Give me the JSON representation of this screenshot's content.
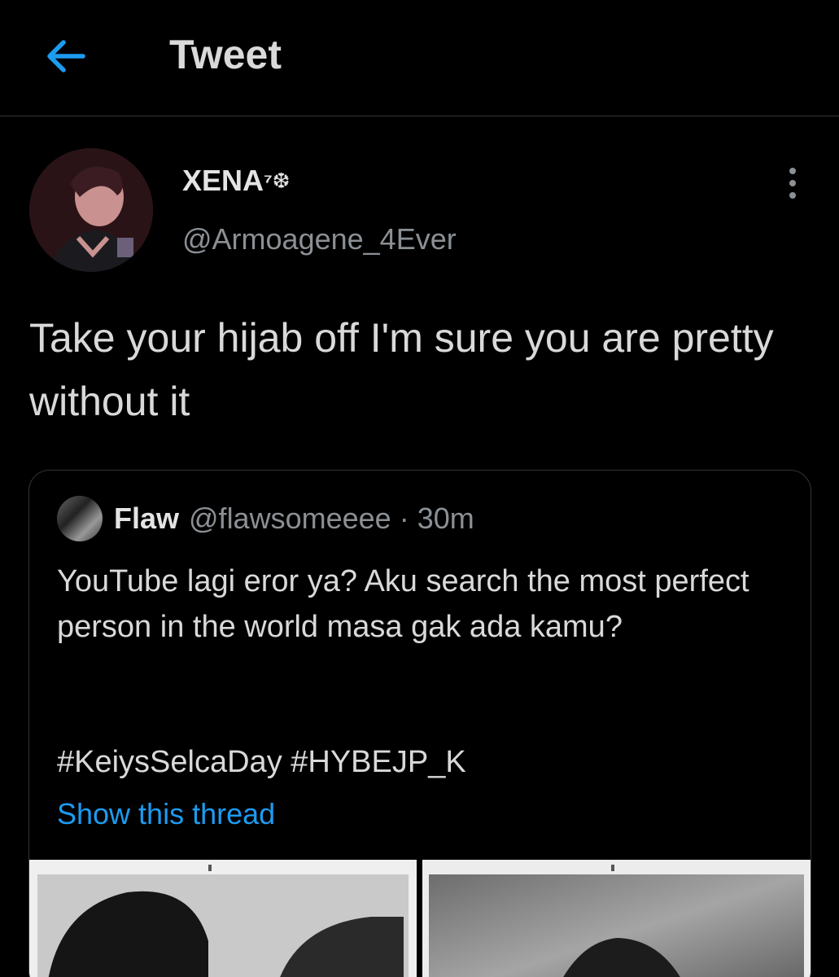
{
  "header": {
    "title": "Tweet",
    "back_icon": "arrow-left-icon",
    "accent_color": "#1d9bf0"
  },
  "tweet": {
    "author": {
      "name": "XENA",
      "name_suffix": "⁷❆",
      "handle": "@Armoagene_4Ever"
    },
    "more_icon": "more-vertical-icon",
    "text": "Take your hijab off I'm sure you are pretty without it"
  },
  "quote": {
    "author": {
      "name": "Flaw",
      "handle": "@flawsomeeee",
      "separator": "·",
      "time": "30m"
    },
    "text": "YouTube lagi eror ya? Aku search the most perfect person in the world masa gak ada kamu?",
    "hashtags": "#KeiysSelcaDay #HYBEJP_K",
    "show_thread": "Show this thread"
  }
}
